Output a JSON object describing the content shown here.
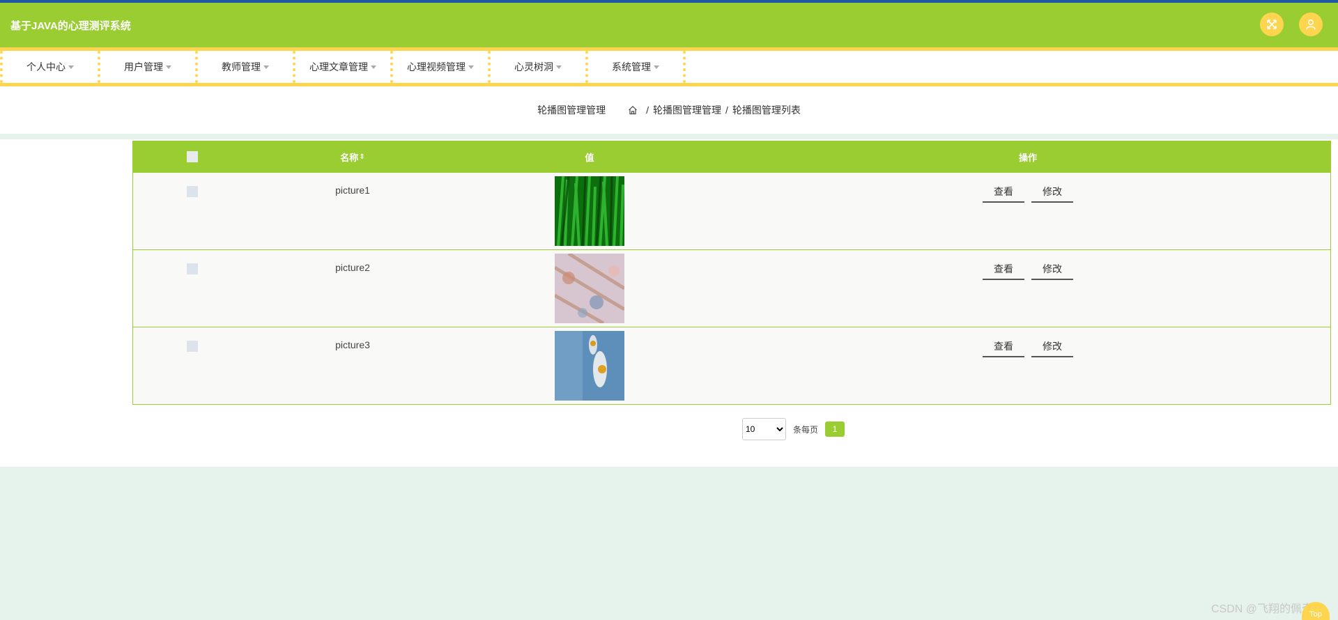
{
  "header": {
    "app_title": "基于JAVA的心理测评系统",
    "icons": [
      "fullscreen-icon",
      "user-icon"
    ],
    "accent_color": "#9acd32",
    "highlight_color": "#fdd54f"
  },
  "nav": {
    "items": [
      {
        "label": "个人中心"
      },
      {
        "label": "用户管理"
      },
      {
        "label": "教师管理"
      },
      {
        "label": "心理文章管理"
      },
      {
        "label": "心理视频管理"
      },
      {
        "label": "心灵树洞"
      },
      {
        "label": "系统管理"
      }
    ]
  },
  "breadcrumb": {
    "title": "轮播图管理管理",
    "items": [
      "轮播图管理管理",
      "轮播图管理列表"
    ],
    "separator": "/"
  },
  "table": {
    "columns": {
      "name": "名称",
      "value": "值",
      "action": "操作"
    },
    "rows": [
      {
        "name": "picture1",
        "image": "green grass"
      },
      {
        "name": "picture2",
        "image": "pink blossom"
      },
      {
        "name": "picture3",
        "image": "blue daisy"
      }
    ],
    "view_label": "查看",
    "edit_label": "修改"
  },
  "pager": {
    "page_size": "10",
    "page_size_options": [
      "10"
    ],
    "per_page_label": "条每页",
    "current_page": "1"
  },
  "footer": {
    "watermark": "CSDN @飞翔的佩奇",
    "top_label": "Top"
  }
}
